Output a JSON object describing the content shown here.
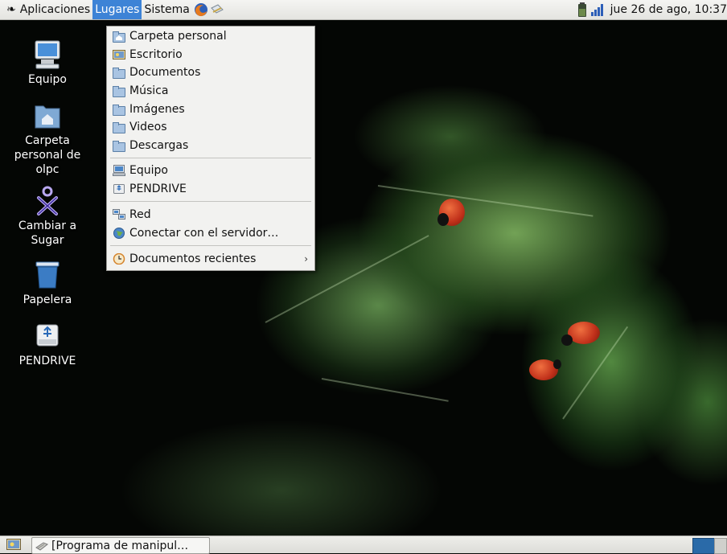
{
  "top_panel": {
    "applications": "Aplicaciones",
    "places": "Lugares",
    "system": "Sistema",
    "clock": "jue 26 de ago, 10:37"
  },
  "places_menu": {
    "items": [
      {
        "label": "Carpeta personal",
        "icon": "home-folder-icon"
      },
      {
        "label": "Escritorio",
        "icon": "desktop-icon"
      },
      {
        "label": "Documentos",
        "icon": "folder-icon"
      },
      {
        "label": "Música",
        "icon": "folder-icon"
      },
      {
        "label": "Imágenes",
        "icon": "folder-icon"
      },
      {
        "label": "Videos",
        "icon": "folder-icon"
      },
      {
        "label": "Descargas",
        "icon": "folder-icon"
      },
      {
        "label": "Equipo",
        "icon": "computer-icon"
      },
      {
        "label": "PENDRIVE",
        "icon": "usb-drive-icon"
      },
      {
        "label": "Red",
        "icon": "network-icon"
      },
      {
        "label": "Conectar con el servidor…",
        "icon": "globe-icon"
      },
      {
        "label": "Documentos recientes",
        "icon": "clock-icon",
        "submenu_arrow": "›"
      }
    ]
  },
  "desktop_icons": [
    {
      "label": "Equipo",
      "icon": "computer-icon"
    },
    {
      "label": "Carpeta personal de olpc",
      "icon": "home-folder-icon"
    },
    {
      "label": "Cambiar a Sugar",
      "icon": "sugar-xo-icon"
    },
    {
      "label": "Papelera",
      "icon": "trash-icon"
    },
    {
      "label": "PENDRIVE",
      "icon": "usb-drive-icon"
    }
  ],
  "bottom_panel": {
    "task_label": "[Programa de manipul…"
  },
  "colors": {
    "menu_highlight": "#3d83d6",
    "panel_bg": "#ececea",
    "workspace_active": "#2a6aa8"
  }
}
